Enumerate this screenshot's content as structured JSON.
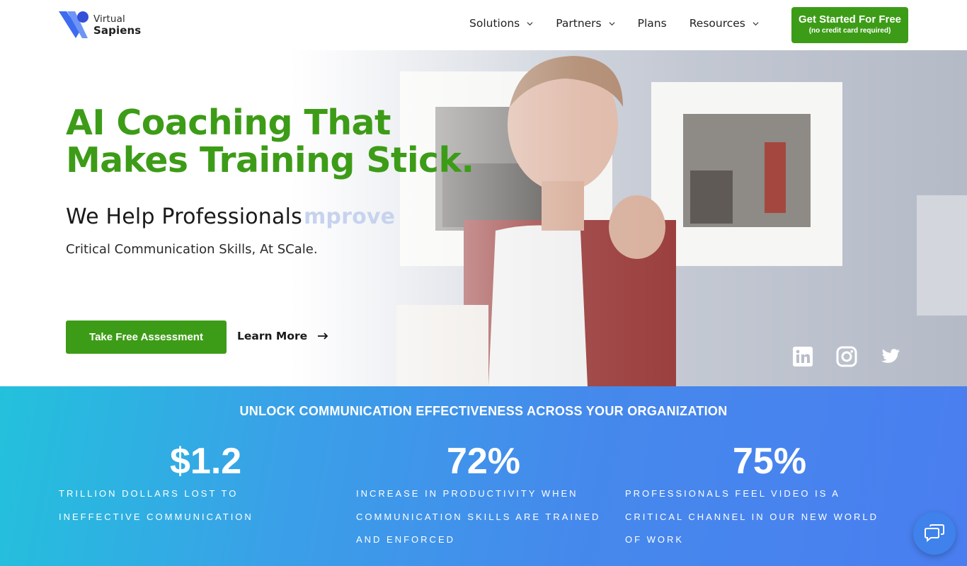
{
  "brand": {
    "line1": "Virtual",
    "line2": "Sapiens",
    "color": "#3d6cf0"
  },
  "nav": {
    "items": [
      {
        "label": "Solutions",
        "has_dropdown": true
      },
      {
        "label": "Partners",
        "has_dropdown": true
      },
      {
        "label": "Plans",
        "has_dropdown": false
      },
      {
        "label": "Resources",
        "has_dropdown": true
      }
    ],
    "cta_main": "Get Started For Free",
    "cta_sub": "(no credit card required)"
  },
  "hero": {
    "headline_line1": "AI Coaching That",
    "headline_line2": "Makes Training Stick.",
    "subhead": "We Help Professionals",
    "rotating_word": "mprove",
    "description": "Critical Communication Skills, At SCale.",
    "primary_button": "Take Free Assessment",
    "secondary_button": "Learn More",
    "socials": [
      "linkedin-icon",
      "instagram-icon",
      "twitter-icon"
    ]
  },
  "stats": {
    "title": "UNLOCK COMMUNICATION EFFECTIVENESS ACROSS YOUR ORGANIZATION",
    "items": [
      {
        "value": "$1.2",
        "label": "TRILLION DOLLARS LOST TO INEFFECTIVE COMMUNICATION"
      },
      {
        "value": "72%",
        "label": "INCREASE IN PRODUCTIVITY WHEN COMMUNICATION SKILLS ARE TRAINED AND ENFORCED"
      },
      {
        "value": "75%",
        "label": "PROFESSIONALS FEEL VIDEO IS A CRITICAL CHANNEL IN OUR NEW WORLD OF WORK"
      }
    ]
  },
  "colors": {
    "green": "#3d9c17",
    "band_start": "#23c1dc",
    "band_end": "#4a7ef0"
  }
}
